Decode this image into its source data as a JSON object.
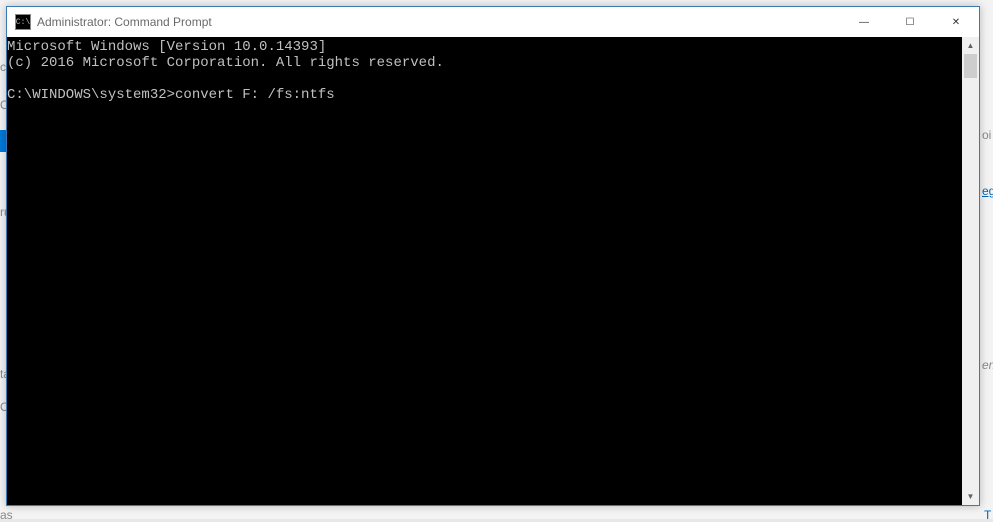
{
  "window": {
    "icon_label": "C:\\",
    "title": "Administrator: Command Prompt",
    "controls": {
      "minimize_glyph": "—",
      "maximize_glyph": "☐",
      "close_glyph": "✕"
    }
  },
  "console": {
    "line1": "Microsoft Windows [Version 10.0.14393]",
    "line2": "(c) 2016 Microsoft Corporation. All rights reserved.",
    "blank": "",
    "prompt": "C:\\WINDOWS\\system32>",
    "command": "convert F: /fs:ntfs"
  },
  "scrollbar": {
    "up_glyph": "▲",
    "down_glyph": "▼"
  },
  "bg": {
    "frag_c": "c",
    "frag_or": "Or",
    "frag_ru": "ru",
    "frag_ta": "ta",
    "frag_or2": "Or",
    "frag_as": "as",
    "frag_oic": "oi",
    "frag_er": "er.",
    "frag_leg": "eg",
    "frag_t": "T"
  }
}
